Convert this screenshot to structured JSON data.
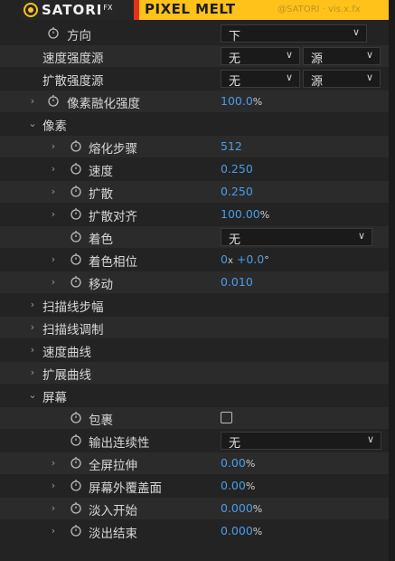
{
  "banner": {
    "brand": "SATORI",
    "fx": "FX",
    "product": "PIXEL MELT",
    "sub": "@SATORI · vis.x.fx"
  },
  "rows": {
    "direction": {
      "label": "方向",
      "value": "下"
    },
    "speed_source": {
      "label": "速度强度源",
      "value1": "无",
      "value2": "源"
    },
    "spread_source": {
      "label": "扩散强度源",
      "value1": "无",
      "value2": "源"
    },
    "pixel_melt_strength": {
      "label": "像素融化强度",
      "value": "100.0",
      "unit": "%"
    },
    "pixels": {
      "label": "像素"
    },
    "melt_steps": {
      "label": "熔化步骤",
      "value": "512"
    },
    "speed": {
      "label": "速度",
      "value": "0.250"
    },
    "spread": {
      "label": "扩散",
      "value": "0.250"
    },
    "spread_align": {
      "label": "扩散对齐",
      "value": "100.00",
      "unit": "%"
    },
    "coloring": {
      "label": "着色",
      "value": "无"
    },
    "color_phase": {
      "label": "着色相位",
      "value_rev": "0",
      "unit_rev": "x",
      "value_deg": "+0.0",
      "unit_deg": "°"
    },
    "move": {
      "label": "移动",
      "value": "0.010"
    },
    "scanline_amplitude": {
      "label": "扫描线步幅"
    },
    "scanline_modulation": {
      "label": "扫描线调制"
    },
    "speed_curve": {
      "label": "速度曲线"
    },
    "spread_curve": {
      "label": "扩展曲线"
    },
    "screen": {
      "label": "屏幕"
    },
    "wrap": {
      "label": "包裹"
    },
    "output_continuity": {
      "label": "输出连续性",
      "value": "无"
    },
    "fullscreen_stretch": {
      "label": "全屏拉伸",
      "value": "0.00",
      "unit": "%"
    },
    "offscreen_cover": {
      "label": "屏幕外覆盖面",
      "value": "0.00",
      "unit": "%"
    },
    "fade_in_start": {
      "label": "淡入开始",
      "value": "0.000",
      "unit": "%"
    },
    "fade_out_end": {
      "label": "淡出结束",
      "value": "0.000",
      "unit": "%"
    }
  },
  "icons": {
    "twirl_closed": "chevron-right-icon",
    "twirl_open": "chevron-down-icon",
    "stopwatch": "stopwatch-icon",
    "dropdown": "chevron-down-icon"
  },
  "colors": {
    "value_blue": "#4a9de8",
    "banner_yellow": "#ffc21a",
    "banner_red": "#e53319",
    "panel_bg": "#232323"
  }
}
